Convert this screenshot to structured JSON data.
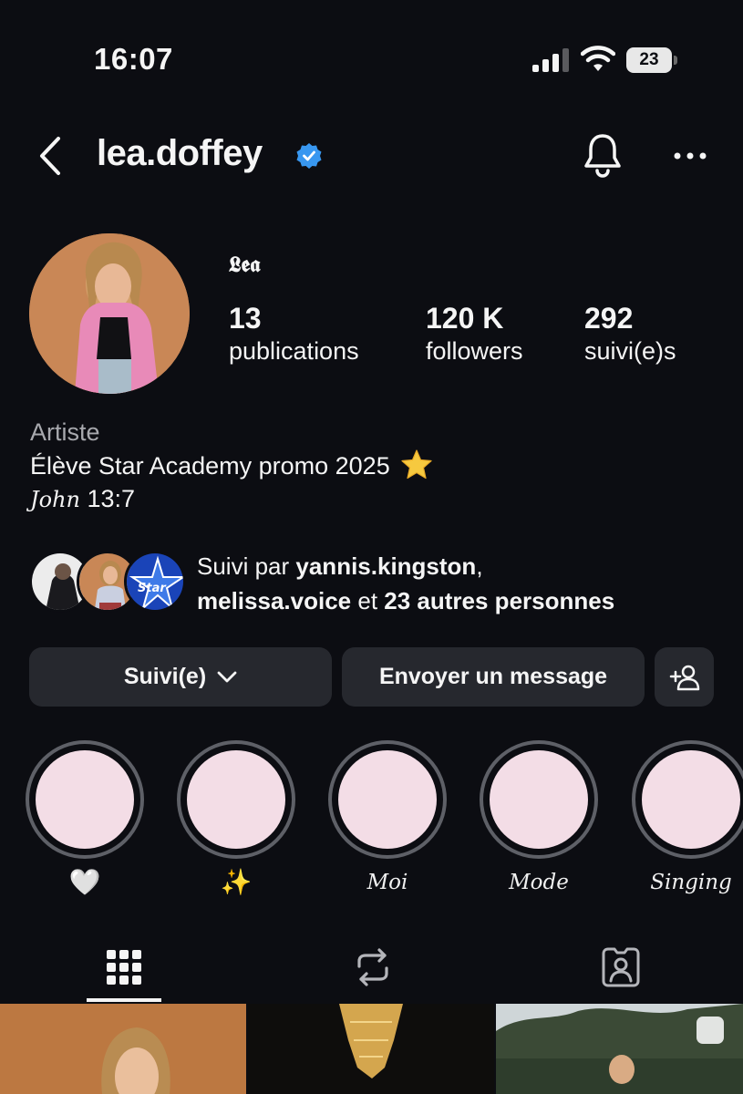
{
  "status_bar": {
    "time": "16:07",
    "battery": "23",
    "icons": [
      "signal-icon",
      "wifi-icon",
      "battery-icon"
    ]
  },
  "header": {
    "username": "lea.doffey",
    "verified": true,
    "icons": [
      "back-icon",
      "verified-icon",
      "bell-icon",
      "more-icon"
    ]
  },
  "profile": {
    "display_name": "𝕷𝖊𝖆",
    "stats": [
      {
        "value": "13",
        "label": "publications"
      },
      {
        "value": "120 K",
        "label": "followers"
      },
      {
        "value": "292",
        "label": "suivi(e)s"
      }
    ],
    "bio": {
      "category": "Artiste",
      "line1": "Élève Star Academy promo 2025",
      "verse_name": "John",
      "verse_ref": "13:7"
    },
    "followed_by": {
      "prefix": "Suivi par",
      "user1": "yannis.kingston",
      "separator": ",",
      "user2": "melissa.voice",
      "conj": "et",
      "others": "23 autres personnes"
    }
  },
  "actions": {
    "follow_label": "Suivi(e)",
    "message_label": "Envoyer un message"
  },
  "highlights": [
    {
      "label": "🤍",
      "emoji": true
    },
    {
      "label": "✨",
      "emoji": true
    },
    {
      "label": "Moi",
      "emoji": false
    },
    {
      "label": "Mode",
      "emoji": false
    },
    {
      "label": "Singing",
      "emoji": false
    }
  ],
  "tabs": [
    "grid-icon",
    "reels-icon",
    "tagged-icon"
  ],
  "colors": {
    "background": "#0c0d12",
    "button": "#26282e",
    "highlight_fill": "#f3dde6",
    "verified": "#3897f0"
  }
}
